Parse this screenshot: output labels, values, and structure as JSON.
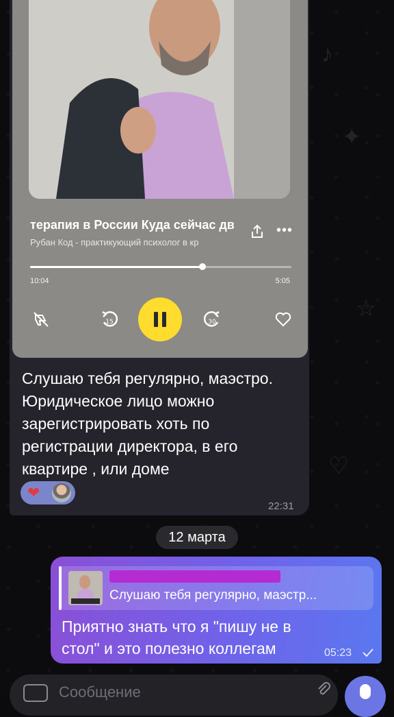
{
  "player": {
    "track_title": "терапия в России  Куда сейчас дв",
    "track_subtitle": "Рубан Код - практикующий психолог в кр",
    "elapsed": "10:04",
    "total": "5:05",
    "progress_fraction": 0.66,
    "rewind_label": "15",
    "forward_label": "30",
    "accent_color": "#ffdc2e"
  },
  "incoming": {
    "text": "Слушаю тебя регулярно, маэстро. Юридическое лицо можно зарегистрировать хоть по регистрации директора, в его квартире , или доме",
    "time": "22:31",
    "reaction_emoji": "❤"
  },
  "date_separator": "12 марта",
  "outgoing": {
    "reply_text": "Слушаю тебя регулярно, маэстр...",
    "text": "Приятно знать что я \"пишу не в стол\" и это полезно коллегам",
    "time": "05:23"
  },
  "composer": {
    "placeholder": "Сообщение"
  }
}
